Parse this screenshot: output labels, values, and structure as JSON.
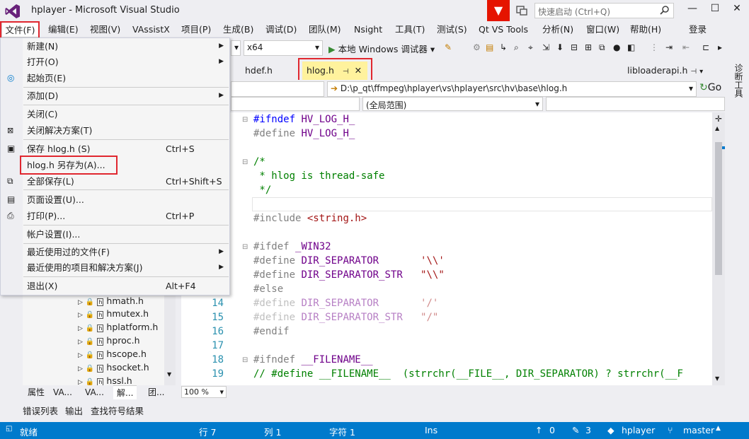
{
  "window": {
    "title": "hplayer - Microsoft Visual Studio"
  },
  "quick_launch": {
    "placeholder": "快速启动 (Ctrl+Q)"
  },
  "menubar": {
    "items": [
      "文件(F)",
      "编辑(E)",
      "视图(V)",
      "VAssistX",
      "项目(P)",
      "生成(B)",
      "调试(D)",
      "团队(M)",
      "Nsight",
      "工具(T)",
      "测试(S)",
      "Qt VS Tools",
      "分析(N)",
      "窗口(W)",
      "帮助(H)"
    ],
    "login": "登录"
  },
  "toolbar": {
    "platform": "x64",
    "run_label": "本地 Windows 调试器"
  },
  "tabs": {
    "hdef": "hdef.h",
    "hlog": "hlog.h",
    "libloader": "libloaderapi.h"
  },
  "navbar": {
    "path": "D:\\p_qt\\ffmpeg\\hplayer\\vs\\hplayer\\src\\hv\\base\\hlog.h",
    "go": "Go"
  },
  "scopebar": {
    "scope": "(全局范围)"
  },
  "right_rail": {
    "label": "诊断工具"
  },
  "editor": {
    "line_numbers": [
      "14",
      "15",
      "16",
      "17",
      "18",
      "19"
    ],
    "zoom": "100 %"
  },
  "file_menu": {
    "new": "新建(N)",
    "open": "打开(O)",
    "start_page": "起始页(E)",
    "add": "添加(D)",
    "close": "关闭(C)",
    "close_solution": "关闭解决方案(T)",
    "save": "保存 hlog.h (S)",
    "save_shortcut": "Ctrl+S",
    "save_as": "hlog.h 另存为(A)...",
    "save_all": "全部保存(L)",
    "save_all_shortcut": "Ctrl+Shift+S",
    "page_setup": "页面设置(U)...",
    "print": "打印(P)...",
    "print_shortcut": "Ctrl+P",
    "account": "帐户设置(I)...",
    "recent_files": "最近使用过的文件(F)",
    "recent_projects": "最近使用的项目和解决方案(J)",
    "exit": "退出(X)",
    "exit_shortcut": "Alt+F4"
  },
  "solution_tree": {
    "files": [
      "hmath.h",
      "hmutex.h",
      "hplatform.h",
      "hproc.h",
      "hscope.h",
      "hsocket.h",
      "hssl.h"
    ]
  },
  "solution_tabs": [
    "属性",
    "VA...",
    "VA...",
    "解...",
    "团..."
  ],
  "bottom_tabs": [
    "错误列表",
    "输出",
    "查找符号结果"
  ],
  "status": {
    "ready": "就绪",
    "line": "行 7",
    "col": "列 1",
    "char": "字符 1",
    "mode": "Ins",
    "up_count": "0",
    "edit_count": "3",
    "repo": "hplayer",
    "branch": "master"
  },
  "colors": {
    "accent": "#007acc",
    "highlight": "#e0272f",
    "active_tab": "#fff29d"
  }
}
